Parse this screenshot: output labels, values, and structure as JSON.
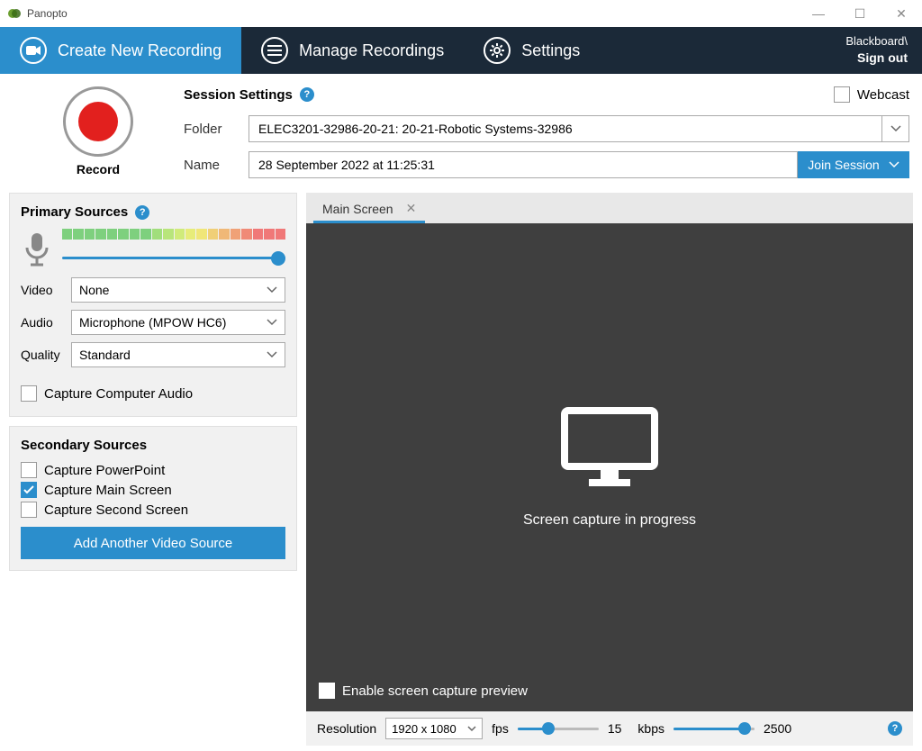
{
  "titlebar": {
    "title": "Panopto"
  },
  "nav": {
    "create": "Create New Recording",
    "manage": "Manage Recordings",
    "settings": "Settings",
    "account_line": "Blackboard\\",
    "signout": "Sign out"
  },
  "session": {
    "heading": "Session Settings",
    "webcast_label": "Webcast",
    "folder_label": "Folder",
    "folder_value": "ELEC3201-32986-20-21: 20-21-Robotic Systems-32986",
    "name_label": "Name",
    "name_value": "28 September 2022 at 11:25:31",
    "join_label": "Join Session",
    "record_label": "Record"
  },
  "primary": {
    "heading": "Primary Sources",
    "video_label": "Video",
    "video_value": "None",
    "audio_label": "Audio",
    "audio_value": "Microphone (MPOW HC6)",
    "quality_label": "Quality",
    "quality_value": "Standard",
    "capture_comp_audio": "Capture Computer Audio"
  },
  "secondary": {
    "heading": "Secondary Sources",
    "powerpoint": "Capture PowerPoint",
    "main_screen": "Capture Main Screen",
    "second_screen": "Capture Second Screen",
    "add_button": "Add Another Video Source"
  },
  "preview": {
    "tab_label": "Main Screen",
    "progress_text": "Screen capture in progress",
    "enable_preview": "Enable screen capture preview"
  },
  "bottom": {
    "resolution_label": "Resolution",
    "resolution_value": "1920 x 1080",
    "fps_label": "fps",
    "fps_value": "15",
    "kbps_label": "kbps",
    "kbps_value": "2500"
  },
  "meter_colors": [
    "#7ed07e",
    "#7ed07e",
    "#7ed07e",
    "#7ed07e",
    "#7ed07e",
    "#7ed07e",
    "#7ed07e",
    "#7ed07e",
    "#a1de7c",
    "#b8e57b",
    "#d0eb7a",
    "#e7ec79",
    "#f0e678",
    "#f0cf77",
    "#f0b877",
    "#f0a177",
    "#f08a77",
    "#f07878",
    "#f07878",
    "#f07878"
  ]
}
